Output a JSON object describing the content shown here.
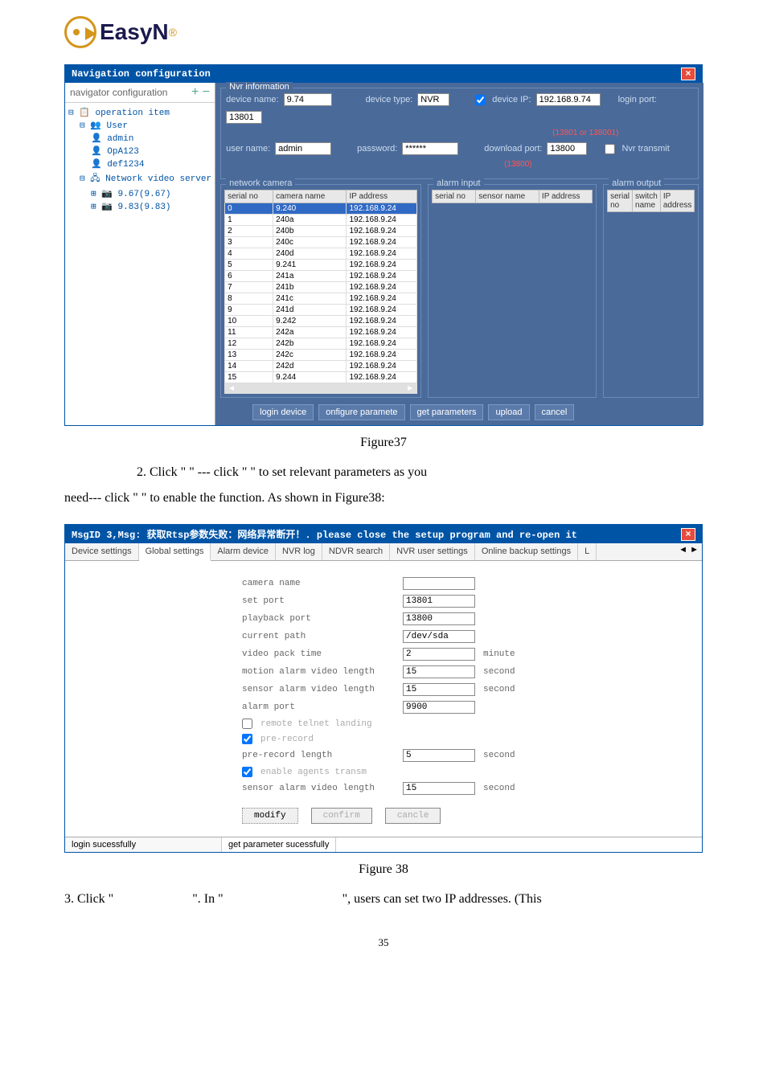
{
  "logo": {
    "text": "EasyN",
    "r": "®"
  },
  "dialog1": {
    "title": "Navigation configuration",
    "nav_header": "navigator configuration",
    "nav_btns": "+ −",
    "tree": [
      {
        "cls": "",
        "icon": "⊟ 📋",
        "text": "operation item"
      },
      {
        "cls": "tree-indent1",
        "icon": "⊟ 👥",
        "text": "User"
      },
      {
        "cls": "tree-indent2",
        "icon": "👤",
        "text": "admin"
      },
      {
        "cls": "tree-indent2",
        "icon": "👤",
        "text": "OpA123"
      },
      {
        "cls": "tree-indent2",
        "icon": "👤",
        "text": "def1234"
      },
      {
        "cls": "tree-indent1",
        "icon": "⊟ 🖧",
        "text": "Network video server"
      },
      {
        "cls": "tree-indent2",
        "icon": "⊞ 📷",
        "text": "9.67(9.67)"
      },
      {
        "cls": "tree-indent2",
        "icon": "⊞ 📷",
        "text": "9.83(9.83)"
      }
    ],
    "nvr_info_label": "Nvr information",
    "info": {
      "device_name_label": "device name:",
      "device_name": "9.74",
      "device_type_label": "device type:",
      "device_type": "NVR",
      "device_ip_label": "device IP:",
      "device_ip": "192.168.9.74",
      "login_port_label": "login port:",
      "login_port": "13801",
      "port_note": "(13801 or 138001)",
      "user_name_label": "user name:",
      "user_name": "admin",
      "password_label": "password:",
      "password": "******",
      "download_port_label": "download port:",
      "download_port": "13800",
      "dl_note": "(13800)",
      "nvr_transmit": "Nvr transmit"
    },
    "col_labels": {
      "c1": "network camera",
      "c2": "alarm input",
      "c3": "alarm output"
    },
    "grid1_headers": [
      "serial no",
      "camera name",
      "IP address"
    ],
    "grid1_rows": [
      [
        "0",
        "9.240",
        "192.168.9.24"
      ],
      [
        "1",
        "240a",
        "192.168.9.24"
      ],
      [
        "2",
        "240b",
        "192.168.9.24"
      ],
      [
        "3",
        "240c",
        "192.168.9.24"
      ],
      [
        "4",
        "240d",
        "192.168.9.24"
      ],
      [
        "5",
        "9.241",
        "192.168.9.24"
      ],
      [
        "6",
        "241a",
        "192.168.9.24"
      ],
      [
        "7",
        "241b",
        "192.168.9.24"
      ],
      [
        "8",
        "241c",
        "192.168.9.24"
      ],
      [
        "9",
        "241d",
        "192.168.9.24"
      ],
      [
        "10",
        "9.242",
        "192.168.9.24"
      ],
      [
        "11",
        "242a",
        "192.168.9.24"
      ],
      [
        "12",
        "242b",
        "192.168.9.24"
      ],
      [
        "13",
        "242c",
        "192.168.9.24"
      ],
      [
        "14",
        "242d",
        "192.168.9.24"
      ],
      [
        "15",
        "9.244",
        "192.168.9.24"
      ]
    ],
    "grid2_headers": [
      "serial no",
      "sensor name",
      "IP address"
    ],
    "grid3_headers": [
      "serial no",
      "switch name",
      "IP address"
    ],
    "buttons": [
      "login device",
      "onfigure paramete",
      "get parameters",
      "upload",
      "cancel"
    ]
  },
  "fig37": "Figure37",
  "para1a": "2.  Click  \"",
  "para1b": "\"  ---  click  \"",
  "para1c": "\"  to  set  relevant  parameters  as  you",
  "para2a": "need--- click    \"",
  "para2b": "\" to enable the function. As shown in Figure38:",
  "dialog2": {
    "title": "MsgID 3,Msg: 获取Rtsp参数失败：网络异常断开！. please close the setup program and re-open it",
    "tabs": [
      "Device settings",
      "Global settings",
      "Alarm device",
      "NVR log",
      "NDVR search",
      "NVR user settings",
      "Online backup settings",
      "L"
    ],
    "active_tab": 1,
    "rows": [
      {
        "label": "camera name",
        "val": "",
        "unit": ""
      },
      {
        "label": "set port",
        "val": "13801",
        "unit": ""
      },
      {
        "label": "playback port",
        "val": "13800",
        "unit": ""
      },
      {
        "label": "current path",
        "val": "/dev/sda",
        "unit": ""
      },
      {
        "label": "video pack time",
        "val": "2",
        "unit": "minute"
      },
      {
        "label": "motion alarm video length",
        "val": "15",
        "unit": "second"
      },
      {
        "label": "sensor alarm video length",
        "val": "15",
        "unit": "second"
      },
      {
        "label": "alarm port",
        "val": "9900",
        "unit": ""
      }
    ],
    "chk1": "remote telnet landing",
    "chk2": "pre-record",
    "row_pre": {
      "label": "pre-record length",
      "val": "5",
      "unit": "second"
    },
    "chk3": "enable agents transm",
    "row_sensor": {
      "label": "sensor alarm video length",
      "val": "15",
      "unit": "second"
    },
    "btns": [
      "modify",
      "confirm",
      "cancle"
    ],
    "status1": "login sucessfully",
    "status2": "get parameter sucessfully"
  },
  "fig38": "Figure 38",
  "para3a": "3.    Click \"",
  "para3b": "\". In \"",
  "para3c": "\", users can set two IP addresses. (This",
  "pagenum": "35"
}
